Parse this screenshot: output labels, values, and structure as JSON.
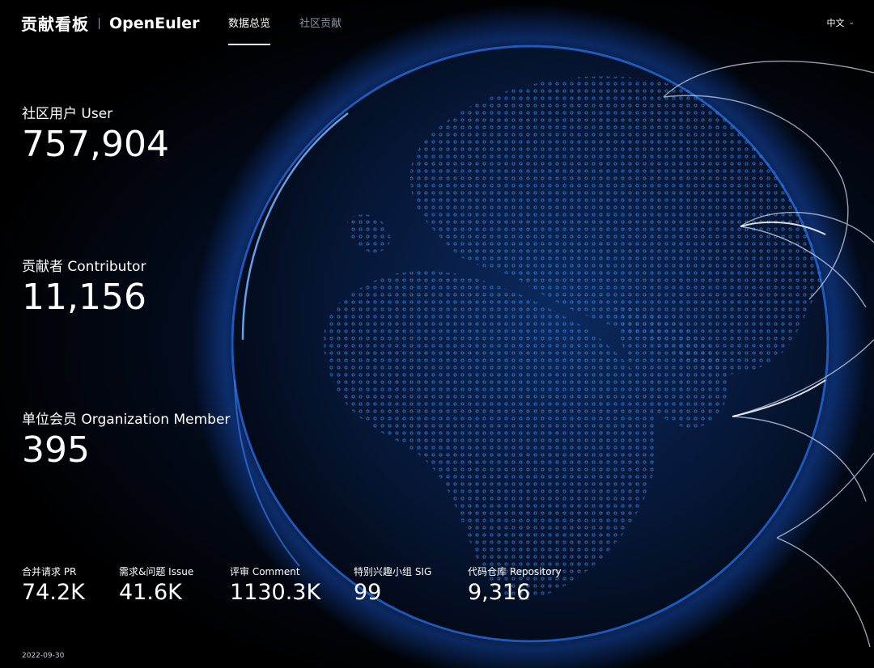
{
  "header": {
    "title": "贡献看板",
    "logo_text": "OpenEuler",
    "nav": [
      {
        "label": "数据总览",
        "active": true
      },
      {
        "label": "社区贡献",
        "active": false
      }
    ],
    "language": "中文",
    "language_icon": "chevron-down-icon"
  },
  "metrics": {
    "user": {
      "label": "社区用户 User",
      "value": "757,904"
    },
    "contributor": {
      "label": "贡献者 Contributor",
      "value": "11,156"
    },
    "organization": {
      "label": "单位会员 Organization Member",
      "value": "395"
    }
  },
  "stats": [
    {
      "label": "合并请求 PR",
      "value": "74.2K"
    },
    {
      "label": "需求&问题 Issue",
      "value": "41.6K"
    },
    {
      "label": "评审 Comment",
      "value": "1130.3K"
    },
    {
      "label": "特别兴趣小组 SIG",
      "value": "99"
    },
    {
      "label": "代码仓库 Repository",
      "value": "9,316"
    }
  ],
  "date": "2022-09-30",
  "colors": {
    "background": "#000000",
    "globe_glow": "#1e6bff",
    "globe_dots": "#2f7fe0",
    "nav_inactive": "#8b93a3"
  }
}
